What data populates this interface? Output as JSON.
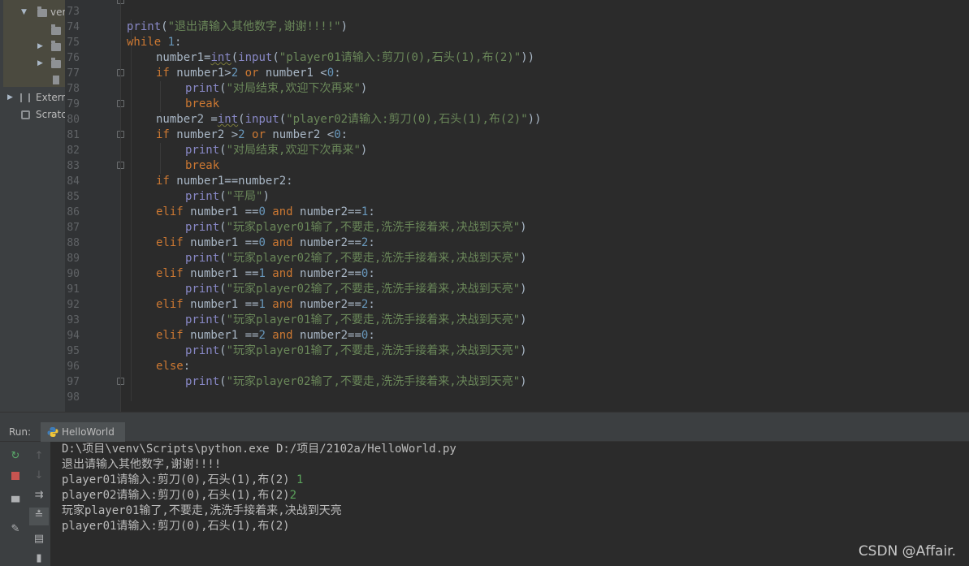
{
  "project_tree": {
    "items": [
      {
        "label": "ven",
        "kind": "folder-expanded"
      },
      {
        "label": "",
        "kind": "folder"
      },
      {
        "label": "",
        "kind": "folder-collapsed"
      },
      {
        "label": "",
        "kind": "folder-collapsed"
      },
      {
        "label": "",
        "kind": "file"
      },
      {
        "label": "Extern",
        "kind": "external-libraries"
      },
      {
        "label": "Scratc",
        "kind": "scratches"
      }
    ]
  },
  "editor": {
    "line_numbers": [
      "73",
      "74",
      "75",
      "76",
      "77",
      "78",
      "79",
      "80",
      "81",
      "82",
      "83",
      "84",
      "85",
      "86",
      "87",
      "88",
      "89",
      "90",
      "91",
      "92",
      "93",
      "94",
      "95",
      "96",
      "97",
      "98"
    ],
    "code": {
      "l74": {
        "fn": "print",
        "p1": "(",
        "s": "\"退出请输入其他数字,谢谢!!!!\"",
        "p2": ")"
      },
      "l75": {
        "kw": "while",
        "sp": " ",
        "n": "1",
        "p": ":"
      },
      "l76": {
        "a": "number1=",
        "fn1": "int",
        "b": "(",
        "fn2": "input",
        "c": "(",
        "s": "\"player01请输入:剪刀(0),石头(1),布(2)\"",
        "d": "))"
      },
      "l77": {
        "kw1": "if",
        "a": " number1>",
        "n1": "2",
        "kw2": " or",
        "b": " number1 <",
        "n2": "0",
        "c": ":"
      },
      "l78": {
        "fn": "print",
        "a": "(",
        "s": "\"对局结束,欢迎下次再来\"",
        "b": ")"
      },
      "l79": {
        "kw": "break"
      },
      "l80": {
        "a": "number2 =",
        "fn1": "int",
        "b": "(",
        "fn2": "input",
        "c": "(",
        "s": "\"player02请输入:剪刀(0),石头(1),布(2)\"",
        "d": "))"
      },
      "l81": {
        "kw1": "if",
        "a": " number2 >",
        "n1": "2",
        "kw2": " or",
        "b": " number2 <",
        "n2": "0",
        "c": ":"
      },
      "l82": {
        "fn": "print",
        "a": "(",
        "s": "\"对局结束,欢迎下次再来\"",
        "b": ")"
      },
      "l83": {
        "kw": "break"
      },
      "l84": {
        "kw": "if",
        "a": " number1==number2:"
      },
      "l85": {
        "fn": "print",
        "a": "(",
        "s": "\"平局\"",
        "b": ")"
      },
      "l86": {
        "kw1": "elif",
        "a": " number1 ==",
        "n1": "0",
        "kw2": " and",
        "b": " number2==",
        "n2": "1",
        "c": ":"
      },
      "l87": {
        "fn": "print",
        "a": "(",
        "s": "\"玩家player01输了,不要走,洗洗手接着来,决战到天亮\"",
        "b": ")"
      },
      "l88": {
        "kw1": "elif",
        "a": " number1 ==",
        "n1": "0",
        "kw2": " and",
        "b": " number2==",
        "n2": "2",
        "c": ":"
      },
      "l89": {
        "fn": "print",
        "a": "(",
        "s": "\"玩家player02输了,不要走,洗洗手接着来,决战到天亮\"",
        "b": ")"
      },
      "l90": {
        "kw1": "elif",
        "a": " number1 ==",
        "n1": "1",
        "kw2": " and",
        "b": " number2==",
        "n2": "0",
        "c": ":"
      },
      "l91": {
        "fn": "print",
        "a": "(",
        "s": "\"玩家player02输了,不要走,洗洗手接着来,决战到天亮\"",
        "b": ")"
      },
      "l92": {
        "kw1": "elif",
        "a": " number1 ==",
        "n1": "1",
        "kw2": " and",
        "b": " number2==",
        "n2": "2",
        "c": ":"
      },
      "l93": {
        "fn": "print",
        "a": "(",
        "s": "\"玩家player01输了,不要走,洗洗手接着来,决战到天亮\"",
        "b": ")"
      },
      "l94": {
        "kw1": "elif",
        "a": " number1 ==",
        "n1": "2",
        "kw2": " and",
        "b": " number2==",
        "n2": "0",
        "c": ":"
      },
      "l95": {
        "fn": "print",
        "a": "(",
        "s": "\"玩家player01输了,不要走,洗洗手接着来,决战到天亮\"",
        "b": ")"
      },
      "l96": {
        "kw": "else",
        "a": ":"
      },
      "l97": {
        "fn": "print",
        "a": "(",
        "s": "\"玩家player02输了,不要走,洗洗手接着来,决战到天亮\"",
        "b": ")"
      }
    }
  },
  "run_window": {
    "label": "Run:",
    "tab_label": "HelloWorld",
    "toolbar_icons": [
      "rerun-icon",
      "stop-icon",
      "up-icon",
      "down-icon",
      "soft-wrap-icon",
      "layout-icon",
      "scroll-to-end-icon",
      "pin-icon",
      "print-icon",
      "trash-icon"
    ],
    "console": {
      "line1": "D:\\项目\\venv\\Scripts\\python.exe D:/项目/2102a/HelloWorld.py",
      "line2": "退出请输入其他数字,谢谢!!!!",
      "line3": "player01请输入:剪刀(0),石头(1),布(2)",
      "line3_input": " 1",
      "line4": "player02请输入:剪刀(0),石头(1),布(2)",
      "line4_input": "2",
      "line5": "玩家player01输了,不要走,洗洗手接着来,决战到天亮",
      "line6": "player01请输入:剪刀(0),石头(1),布(2)"
    }
  },
  "watermark": "CSDN @Affair.",
  "colors": {
    "keyword": "#cc7832",
    "builtin": "#8888c6",
    "number": "#6897bb",
    "string": "#6a8759",
    "console_input": "#5ba35b",
    "background": "#2b2b2b"
  }
}
